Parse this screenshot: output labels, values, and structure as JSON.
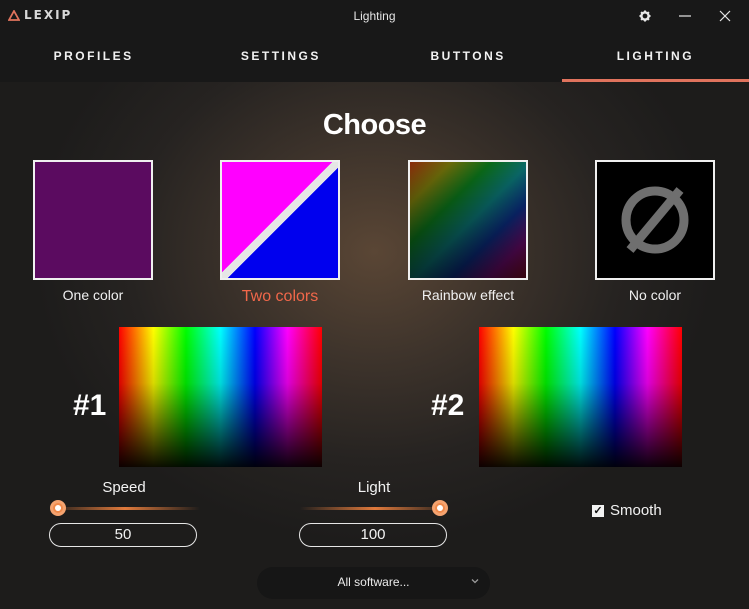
{
  "app": {
    "logo_text": "LEXIP",
    "window_title": "Lighting"
  },
  "tabs": [
    {
      "label": "PROFILES",
      "active": false
    },
    {
      "label": "SETTINGS",
      "active": false
    },
    {
      "label": "BUTTONS",
      "active": false
    },
    {
      "label": "LIGHTING",
      "active": true
    }
  ],
  "heading": "Choose",
  "color_modes": [
    {
      "label": "One color",
      "selected": false,
      "color": "#5b0b60"
    },
    {
      "label": "Two colors",
      "selected": true,
      "colors": [
        "#ff00ff",
        "#0000ee"
      ]
    },
    {
      "label": "Rainbow effect",
      "selected": false
    },
    {
      "label": "No color",
      "selected": false,
      "icon": "empty-set-icon"
    }
  ],
  "pickers": [
    {
      "label": "#1"
    },
    {
      "label": "#2"
    }
  ],
  "speed": {
    "label": "Speed",
    "value": "50",
    "fraction": 0.0
  },
  "light": {
    "label": "Light",
    "value": "100",
    "fraction": 1.0
  },
  "smooth": {
    "label": "Smooth",
    "checked": true
  },
  "software_select": {
    "value": "All software..."
  },
  "colors": {
    "accent": "#e0735d",
    "selected_label": "#f0674a",
    "slider": "#f08a4b"
  }
}
